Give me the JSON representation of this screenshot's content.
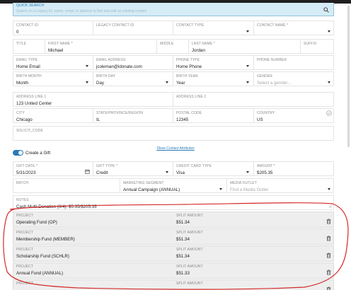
{
  "quick_search": {
    "label": "QUICK SEARCH",
    "placeholder": "Search on a Legacy ID, name, email, or address to find and edit an existing contact"
  },
  "contact_row": {
    "contact_id": {
      "label": "CONTACT ID",
      "value": "0"
    },
    "legacy_contact_id": {
      "label": "LEGACY CONTACT ID",
      "value": ""
    },
    "contact_type": {
      "label": "CONTACT TYPE",
      "value": ""
    },
    "contact_name": {
      "label": "CONTACT NAME *",
      "value": ""
    }
  },
  "name_row": {
    "title": {
      "label": "TITLE",
      "value": ""
    },
    "first_name": {
      "label": "FIRST NAME *",
      "value": "Michael"
    },
    "middle": {
      "label": "MIDDLE",
      "value": ""
    },
    "last_name": {
      "label": "LAST NAME *",
      "value": "Jordan"
    },
    "suffix": {
      "label": "SUFFIX",
      "value": ""
    }
  },
  "contact_info_row": {
    "email_type": {
      "label": "EMAIL TYPE",
      "value": "Home Email"
    },
    "email_address": {
      "label": "EMAIL ADDRESS",
      "value": "jcoleman@idonate.com"
    },
    "phone_type": {
      "label": "PHONE TYPE",
      "value": "Home Phone"
    },
    "phone_number": {
      "label": "PHONE NUMBER",
      "value": ""
    }
  },
  "birth_row": {
    "birth_month": {
      "label": "BIRTH MONTH",
      "value": "Month"
    },
    "birth_day": {
      "label": "BIRTH DAY",
      "value": "Day"
    },
    "birth_year": {
      "label": "BIRTH YEAR",
      "value": "Year"
    },
    "gender": {
      "label": "GENDER",
      "placeholder": "Select a gender..."
    }
  },
  "address_row": {
    "line1": {
      "label": "ADDRESS LINE 1",
      "value": "123 United Center"
    },
    "line2": {
      "label": "ADDRESS LINE 2",
      "value": ""
    }
  },
  "city_row": {
    "city": {
      "label": "CITY",
      "value": "Chicago"
    },
    "state": {
      "label": "STATE/PROVINCE/REGION",
      "value": "IL"
    },
    "postal": {
      "label": "POSTAL CODE",
      "value": "12345"
    },
    "country": {
      "label": "COUNTRY",
      "value": "US"
    }
  },
  "solicit_code": {
    "label": "SOLICIT_CODE",
    "value": ""
  },
  "show_attributes_link": "Show Contact Attributes",
  "create_gift": {
    "label": "Create a Gift",
    "enabled": true
  },
  "gift_row": {
    "gift_date": {
      "label": "GIFT DATE *",
      "value": "5/31/2023"
    },
    "gift_type": {
      "label": "GIFT TYPE *",
      "value": "Credit"
    },
    "card_type": {
      "label": "CREDIT CARD TYPE",
      "value": "Visa"
    },
    "amount": {
      "label": "AMOUNT *",
      "value": "$205.35"
    }
  },
  "batch_row": {
    "batch": {
      "label": "BATCH",
      "value": ""
    },
    "marketing_segment": {
      "label": "MARKETING SEGMENT",
      "value": "Annual Campaign (ANNUAL)"
    },
    "media_outlet": {
      "label": "MEDIA OUTLET",
      "placeholder": "Find a Media Outlet"
    }
  },
  "notes": {
    "label": "NOTES",
    "value": "Cash Multi-Donation (0/4): $5.35/$205.35"
  },
  "splits": [
    {
      "project_label": "PROJECT",
      "project": "Operating Fund (OP)",
      "amount_label": "SPLIT AMOUNT",
      "amount": "$51.34"
    },
    {
      "project_label": "PROJECT",
      "project": "Membership Fund (MEMBER)",
      "amount_label": "SPLIT AMOUNT",
      "amount": "$51.34"
    },
    {
      "project_label": "PROJECT",
      "project": "Scholarship Fund (SCHLR)",
      "amount_label": "SPLIT AMOUNT",
      "amount": "$51.34"
    },
    {
      "project_label": "PROJECT",
      "project": "Annual Fund (ANNUAL)",
      "amount_label": "SPLIT AMOUNT",
      "amount": "$51.33"
    },
    {
      "project_label": "PROJECT",
      "project": "",
      "amount_label": "SPLIT AMOUNT",
      "amount": ""
    }
  ],
  "colors": {
    "accent": "#2a7ab8",
    "annotation": "#d42a2a",
    "search_bg": "#d5ecf6"
  },
  "icons": {
    "search": "search-icon",
    "calendar": "calendar-icon",
    "trash": "trash-icon",
    "check": "check-circle-icon"
  }
}
